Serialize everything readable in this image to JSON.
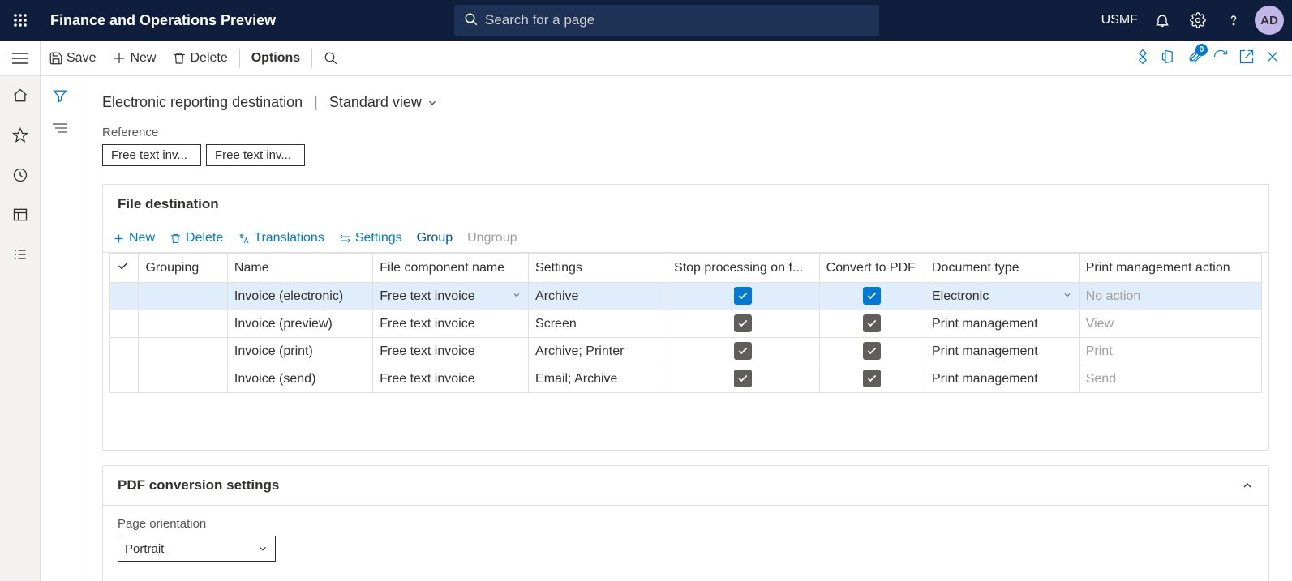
{
  "header": {
    "app_title": "Finance and Operations Preview",
    "search_placeholder": "Search for a page",
    "company": "USMF",
    "avatar_initials": "AD",
    "attachment_badge": "0"
  },
  "actions": {
    "save": "Save",
    "new": "New",
    "delete": "Delete",
    "options": "Options"
  },
  "page": {
    "title": "Electronic reporting destination",
    "view": "Standard view"
  },
  "reference": {
    "label": "Reference",
    "items": [
      "Free text inv...",
      "Free text inv..."
    ]
  },
  "file_dest": {
    "title": "File destination",
    "toolbar": {
      "new": "New",
      "delete": "Delete",
      "translations": "Translations",
      "settings": "Settings",
      "group": "Group",
      "ungroup": "Ungroup"
    },
    "columns": {
      "grouping": "Grouping",
      "name": "Name",
      "component": "File component name",
      "settings": "Settings",
      "stop": "Stop processing on f...",
      "convert": "Convert to PDF",
      "doc_type": "Document type",
      "action": "Print management action"
    },
    "rows": [
      {
        "grouping": "",
        "name": "Invoice (electronic)",
        "component": "Free text invoice",
        "settings": "Archive",
        "stop": true,
        "convert": true,
        "doc_type": "Electronic",
        "action": "No action",
        "selected": true,
        "stop_style": "blue",
        "convert_style": "blue"
      },
      {
        "grouping": "",
        "name": "Invoice (preview)",
        "component": "Free text invoice",
        "settings": "Screen",
        "stop": true,
        "convert": true,
        "doc_type": "Print management",
        "action": "View",
        "selected": false,
        "stop_style": "grey",
        "convert_style": "grey"
      },
      {
        "grouping": "",
        "name": "Invoice (print)",
        "component": "Free text invoice",
        "settings": "Archive; Printer",
        "stop": true,
        "convert": true,
        "doc_type": "Print management",
        "action": "Print",
        "selected": false,
        "stop_style": "grey",
        "convert_style": "grey"
      },
      {
        "grouping": "",
        "name": "Invoice (send)",
        "component": "Free text invoice",
        "settings": "Email; Archive",
        "stop": true,
        "convert": true,
        "doc_type": "Print management",
        "action": "Send",
        "selected": false,
        "stop_style": "grey",
        "convert_style": "grey"
      }
    ]
  },
  "pdf": {
    "title": "PDF conversion settings",
    "orientation_label": "Page orientation",
    "orientation_value": "Portrait"
  }
}
